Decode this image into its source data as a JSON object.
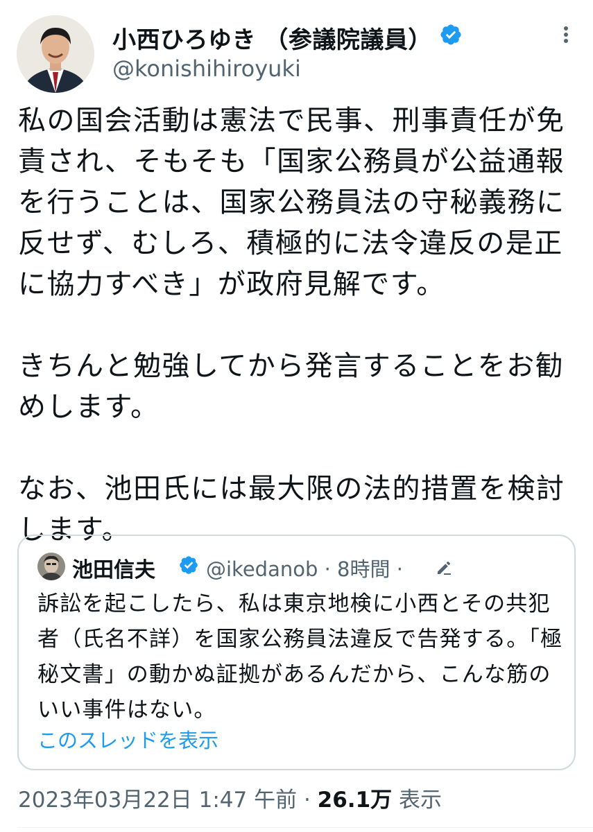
{
  "author": {
    "display_name": "小西ひろゆき （参議院議員）",
    "handle": "@konishihiroyuki"
  },
  "tweet": {
    "text": "私の国会活動は憲法で民事、刑事責任が免責され、そもそも「国家公務員が公益通報を行うことは、国家公務員法の守秘義務に反せず、むしろ、積極的に法令違反の是正に協力すべき」が政府見解です。\n\nきちんと勉強してから発言することをお勧めします。\n\nなお、池田氏には最大限の法的措置を検討します。"
  },
  "quoted_tweet": {
    "display_name": "池田信夫",
    "handle_time": "@ikedanob · 8時間 ·",
    "text": "訴訟を起こしたら、私は東京地検に小西とその共犯者（氏名不詳）を国家公務員法違反で告発する。「極秘文書」の動かぬ証拠があるんだから、こんな筋のいい事件はない。",
    "thread_link": "このスレッドを表示"
  },
  "footer": {
    "timestamp": "2023年03月22日 1:47 午前",
    "separator": " · ",
    "views_count": "26.1万",
    "views_label": " 表示"
  },
  "colors": {
    "text": "#0f1419",
    "secondary": "#536471",
    "link": "#1d9bf0",
    "verified": "#1d9bf0",
    "border": "#cfd9de"
  },
  "icons": [
    "verified-badge-icon",
    "more-options-icon",
    "edit-pencil-icon"
  ]
}
